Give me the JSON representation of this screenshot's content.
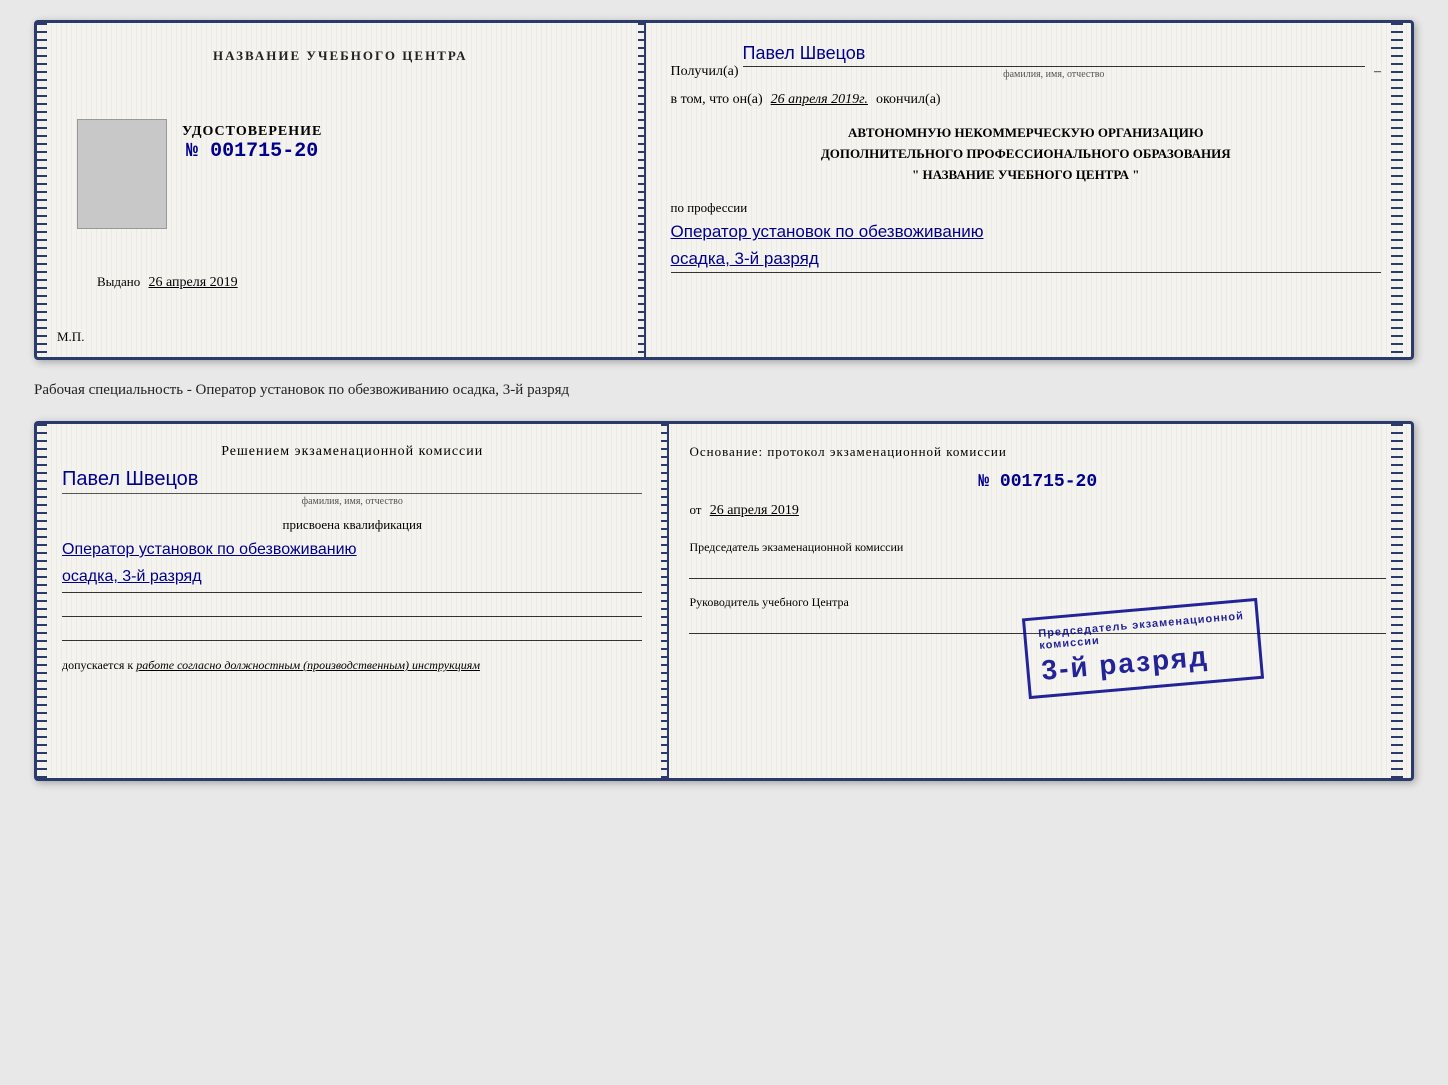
{
  "doc1": {
    "left": {
      "center_title": "НАЗВАНИЕ УЧЕБНОГО ЦЕНТРА",
      "cert_label": "УДОСТОВЕРЕНИЕ",
      "cert_number": "№ 001715-20",
      "issued_prefix": "Выдано",
      "issued_date": "26 апреля 2019",
      "mp_label": "М.П."
    },
    "right": {
      "received_prefix": "Получил(а)",
      "received_name": "Павел Швецов",
      "received_name_sub": "фамилия, имя, отчество",
      "dash": "–",
      "completed_prefix": "в том, что он(а)",
      "completed_date": "26 апреля 2019г.",
      "completed_suffix": "окончил(а)",
      "org_line1": "АВТОНОМНУЮ НЕКОММЕРЧЕСКУЮ ОРГАНИЗАЦИЮ",
      "org_line2": "ДОПОЛНИТЕЛЬНОГО ПРОФЕССИОНАЛЬНОГО ОБРАЗОВАНИЯ",
      "org_line3": "\" НАЗВАНИЕ УЧЕБНОГО ЦЕНТРА \"",
      "profession_label": "по профессии",
      "profession_value": "Оператор установок по обезвоживанию",
      "rank_value": "осадка, 3-й разряд"
    }
  },
  "caption": "Рабочая специальность - Оператор установок по обезвоживанию осадка, 3-й разряд",
  "doc2": {
    "left": {
      "decision_title": "Решением экзаменационной комиссии",
      "person_name": "Павел Швецов",
      "person_name_sub": "фамилия, имя, отчество",
      "qualification_prefix": "присвоена квалификация",
      "qualification_line1": "Оператор установок по обезвоживанию",
      "qualification_line2": "осадка, 3-й разряд",
      "allowed_prefix": "допускается к",
      "allowed_text": "работе согласно должностным (производственным) инструкциям"
    },
    "right": {
      "basis_text": "Основание: протокол экзаменационной комиссии",
      "protocol_number": "№ 001715-20",
      "from_prefix": "от",
      "from_date": "26 апреля 2019",
      "chairman_label": "Председатель экзаменационной комиссии",
      "director_label": "Руководитель учебного Центра"
    },
    "stamp": {
      "prefix": "Председатель экзаменационной",
      "main": "3-й разряд"
    }
  }
}
